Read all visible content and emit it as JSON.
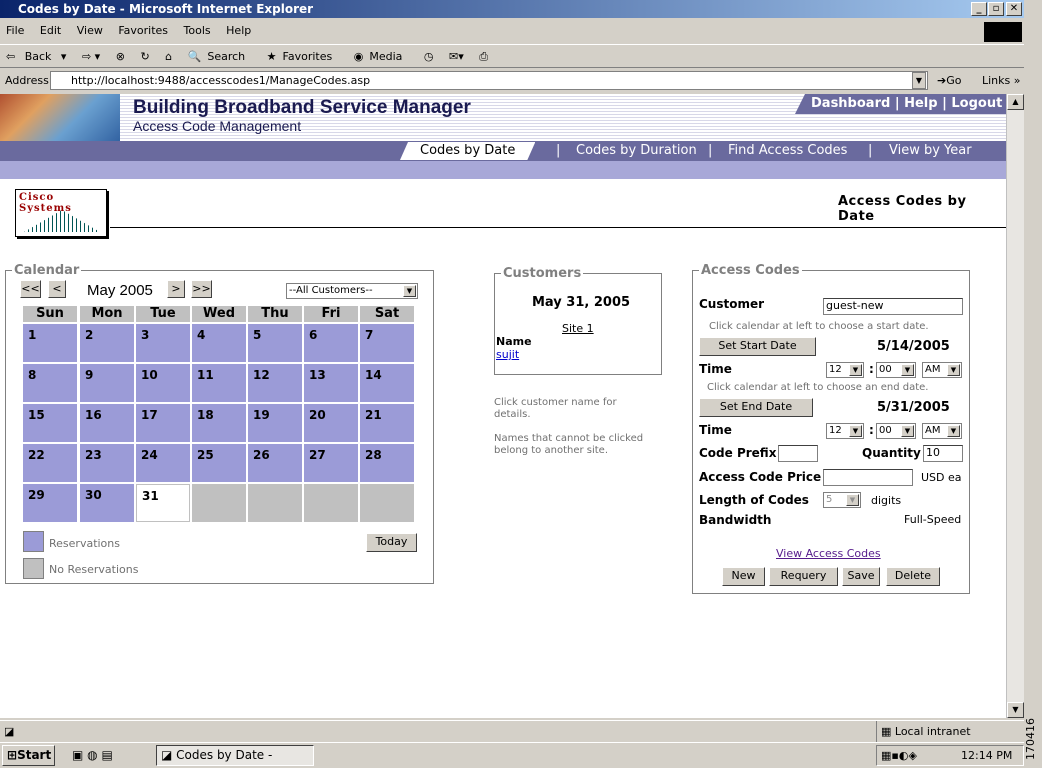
{
  "window": {
    "title": "Codes by Date - Microsoft Internet Explorer"
  },
  "menu": [
    "File",
    "Edit",
    "View",
    "Favorites",
    "Tools",
    "Help"
  ],
  "toolbar": {
    "back": "Back",
    "search": "Search",
    "favorites": "Favorites",
    "media": "Media"
  },
  "address": {
    "label": "Address",
    "url": "http://localhost:9488/accesscodes1/ManageCodes.asp",
    "go": "Go",
    "links": "Links"
  },
  "header": {
    "title": "Building Broadband Service Manager",
    "subtitle": "Access Code Management",
    "links": [
      "Dashboard",
      "Help",
      "Logout"
    ]
  },
  "nav": {
    "tabs": [
      "Codes by Date",
      "Codes by Duration",
      "Find Access Codes",
      "View by Year"
    ],
    "active": 0
  },
  "logo": {
    "text": "Cisco Systems"
  },
  "page_heading": "Access Codes by Date",
  "calendar": {
    "legend": "Calendar",
    "month": "May 2005",
    "prev_year": "<<",
    "prev": "<",
    "next": ">",
    "next_year": ">>",
    "customer_filter": "--All Customers--",
    "days_of_week": [
      "Sun",
      "Mon",
      "Tue",
      "Wed",
      "Thu",
      "Fri",
      "Sat"
    ],
    "dates": [
      "1",
      "2",
      "3",
      "4",
      "5",
      "6",
      "7",
      "8",
      "9",
      "10",
      "11",
      "12",
      "13",
      "14",
      "15",
      "16",
      "17",
      "18",
      "19",
      "20",
      "21",
      "22",
      "23",
      "24",
      "25",
      "26",
      "27",
      "28",
      "29",
      "30",
      "31"
    ],
    "selected": "31",
    "legend_reservations": "Reservations",
    "legend_no_reservations": "No Reservations",
    "today_button": "Today",
    "colors": {
      "reservations": "#9b9bd7",
      "no_reservations": "#c0c0c0"
    }
  },
  "customers": {
    "legend": "Customers",
    "date": "May 31, 2005",
    "site": "Site 1",
    "name_label": "Name",
    "name": "sujit",
    "note1": "Click customer name for details.",
    "note2": "Names that cannot be clicked belong to another site."
  },
  "access_codes": {
    "legend": "Access Codes",
    "customer_label": "Customer",
    "customer_value": "guest-new",
    "start_hint": "Click calendar at left to choose a start date.",
    "set_start": "Set Start Date",
    "start_date": "5/14/2005",
    "time_label": "Time",
    "start_hour": "12",
    "start_min": "00",
    "start_ampm": "AM",
    "end_hint": "Click calendar at left to choose an end date.",
    "set_end": "Set End Date",
    "end_date": "5/31/2005",
    "end_hour": "12",
    "end_min": "00",
    "end_ampm": "AM",
    "prefix_label": "Code Prefix",
    "prefix_value": "",
    "quantity_label": "Quantity",
    "quantity_value": "10",
    "price_label": "Access Code Price",
    "price_value": "",
    "price_unit": "USD ea",
    "length_label": "Length of Codes",
    "length_value": "5",
    "length_unit": "digits",
    "bandwidth_label": "Bandwidth",
    "bandwidth_value": "Full-Speed",
    "view_link": "View Access Codes",
    "buttons": [
      "New",
      "Requery",
      "Save",
      "Delete"
    ]
  },
  "status": {
    "zone": "Local intranet"
  },
  "taskbar": {
    "start": "Start",
    "task": "Codes by Date - Micro...",
    "clock": "12:14 PM"
  },
  "side_number": "170416"
}
